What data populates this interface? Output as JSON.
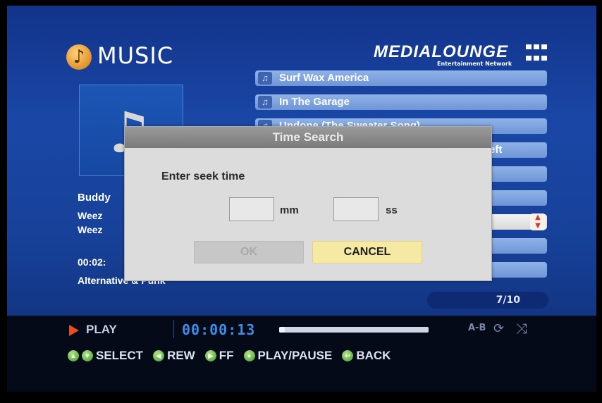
{
  "header": {
    "logo_glyph": "ѕ",
    "title": "MUSIC",
    "brand": "MEDIALOUNGE",
    "brand_sub": "Entertainment Network"
  },
  "now_playing": {
    "title": "Buddy",
    "artist": "Weez",
    "album": "Weez",
    "time": "00:02:",
    "genre": "Alternative & Punk"
  },
  "playlist": {
    "tracks": [
      {
        "label": "Surf Wax America",
        "icon": "music-note-icon"
      },
      {
        "label": "In The Garage",
        "icon": "music-note-icon"
      },
      {
        "label": "Undone (The Sweater Song)",
        "icon": "music-note-icon"
      },
      {
        "label": "eft",
        "icon": ""
      },
      {
        "label": "",
        "icon": ""
      },
      {
        "label": "",
        "icon": ""
      },
      {
        "label": "",
        "icon": ""
      },
      {
        "label": "",
        "icon": ""
      },
      {
        "label": "",
        "icon": ""
      }
    ],
    "page": "7/10"
  },
  "dialog": {
    "title": "Time Search",
    "prompt": "Enter seek time",
    "minutes_value": "",
    "minutes_unit": "mm",
    "seconds_value": "",
    "seconds_unit": "ss",
    "ok_label": "OK",
    "cancel_label": "CANCEL"
  },
  "transport": {
    "state": "PLAY",
    "timecode": "00:00:13",
    "progress": 0.04,
    "ab_label": "A-B"
  },
  "hints": [
    {
      "label": "SELECT"
    },
    {
      "label": "REW"
    },
    {
      "label": "FF"
    },
    {
      "label": "PLAY/PAUSE"
    },
    {
      "label": "BACK"
    }
  ],
  "colors": {
    "accent_timecode": "#3f8de6",
    "cancel_highlight": "#f5e9a4",
    "play_arrow": "#e94e1a"
  }
}
